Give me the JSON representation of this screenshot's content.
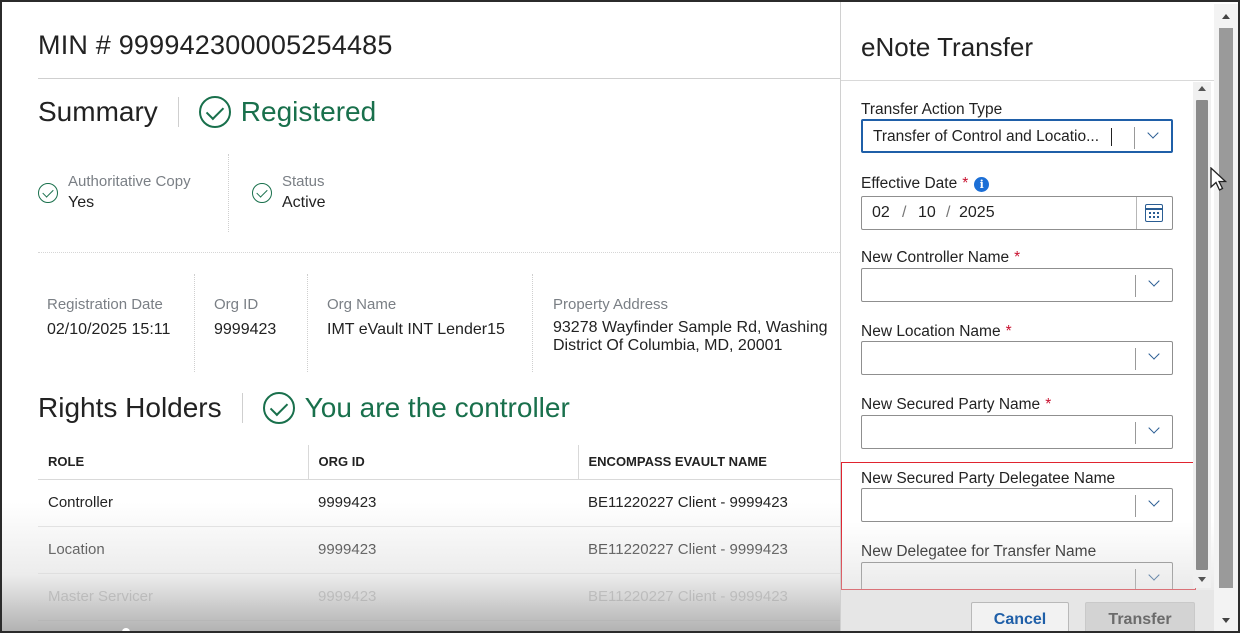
{
  "main": {
    "min_title": "MIN # 999942300005254485",
    "summary": {
      "heading": "Summary",
      "status": "Registered",
      "authoritative_copy": {
        "label": "Authoritative Copy",
        "value": "Yes"
      },
      "status_field": {
        "label": "Status",
        "value": "Active"
      },
      "registration_date": {
        "label": "Registration Date",
        "value": "02/10/2025 15:11"
      },
      "org_id": {
        "label": "Org ID",
        "value": "9999423"
      },
      "org_name": {
        "label": "Org Name",
        "value": "IMT eVault INT Lender15"
      },
      "property_address": {
        "label": "Property Address",
        "line1": "93278 Wayfinder Sample Rd, Washing",
        "line2": "District Of Columbia, MD, 20001"
      }
    },
    "rights_holders": {
      "heading": "Rights Holders",
      "status": "You are the controller",
      "columns": [
        "ROLE",
        "ORG ID",
        "ENCOMPASS EVAULT NAME"
      ],
      "rows": [
        [
          "Controller",
          "9999423",
          "BE11220227 Client - 9999423"
        ],
        [
          "Location",
          "9999423",
          "BE11220227 Client - 9999423"
        ],
        [
          "Master Servicer",
          "9999423",
          "BE11220227 Client - 9999423"
        ]
      ]
    }
  },
  "panel": {
    "title": "eNote Transfer",
    "transfer_action_type": {
      "label": "Transfer Action Type",
      "value": "Transfer of Control and Locatio..."
    },
    "effective_date": {
      "label": "Effective Date",
      "required": "*",
      "info": "i",
      "month": "02",
      "day": "10",
      "year": "2025",
      "separator": "/"
    },
    "new_controller_name": {
      "label": "New Controller Name",
      "required": "*",
      "value": ""
    },
    "new_location_name": {
      "label": "New Location Name",
      "required": "*",
      "value": ""
    },
    "new_secured_party_name": {
      "label": "New Secured Party Name",
      "required": "*",
      "value": ""
    },
    "new_secured_party_delegatee_name": {
      "label": "New Secured Party Delegatee Name",
      "value": ""
    },
    "new_delegatee_for_transfer_name": {
      "label": "New Delegatee for Transfer Name",
      "value": ""
    },
    "buttons": {
      "cancel": "Cancel",
      "transfer": "Transfer"
    }
  },
  "colors": {
    "accent_green": "#19704c",
    "link_blue": "#1f5fa8",
    "required_red": "#c8102e",
    "highlight_red": "#e0242f"
  }
}
